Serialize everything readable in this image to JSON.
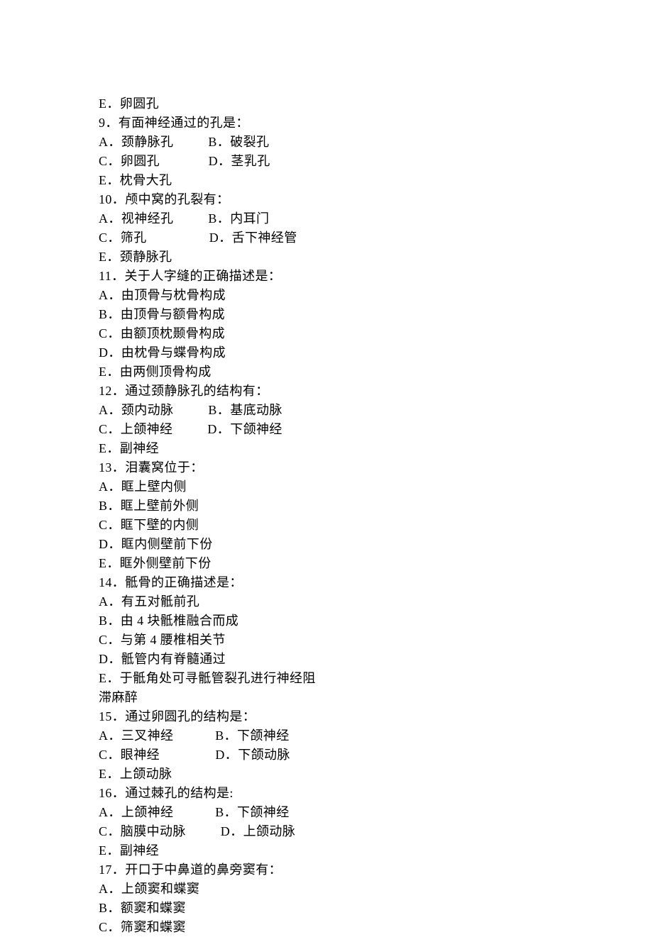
{
  "lines": [
    "E．卵圆孔",
    "9．有面神经通过的孔是：",
    "A．颈静脉孔          B．破裂孔",
    "C．卵圆孔              D．茎乳孔",
    "E．枕骨大孔",
    "10．颅中窝的孔裂有：",
    "A．视神经孔          B．内耳门",
    "C．筛孔                  D．舌下神经管",
    "E．颈静脉孔",
    "11．关于人字缝的正确描述是：",
    "A．由顶骨与枕骨构成",
    "B．由顶骨与额骨构成",
    "C．由额顶枕颞骨构成",
    "D．由枕骨与蝶骨构成",
    "E．由两侧顶骨构成",
    "12．通过颈静脉孔的结构有：",
    "A．颈内动脉          B．基底动脉",
    "C．上颌神经          D．下颌神经",
    "E．副神经",
    "13．泪囊窝位于：",
    "A．眶上壁内侧",
    "B．眶上壁前外侧",
    "C．眶下壁的内侧",
    "D．眶内侧壁前下份",
    "E．眶外侧壁前下份",
    "14．骶骨的正确描述是：",
    "A．有五对骶前孔",
    "B．由 4 块骶椎融合而成",
    "C．与第 4 腰椎相关节",
    "D．骶管内有脊髓通过",
    "E．于骶角处可寻骶管裂孔进行神经阻",
    "滞麻醉",
    "15．通过卵圆孔的结构是：",
    "A．三叉神经            B．下颌神经",
    "C．眼神经                D．下颌动脉",
    "E．上颌动脉",
    "16．通过棘孔的结构是:",
    "A．上颌神经            B．下颌神经",
    "C．脑膜中动脉          D．上颌动脉",
    "E．副神经",
    "17．开口于中鼻道的鼻旁窦有：",
    "A．上颌窦和蝶窦",
    "B．额窦和蝶窦",
    "C．筛窦和蝶窦"
  ]
}
